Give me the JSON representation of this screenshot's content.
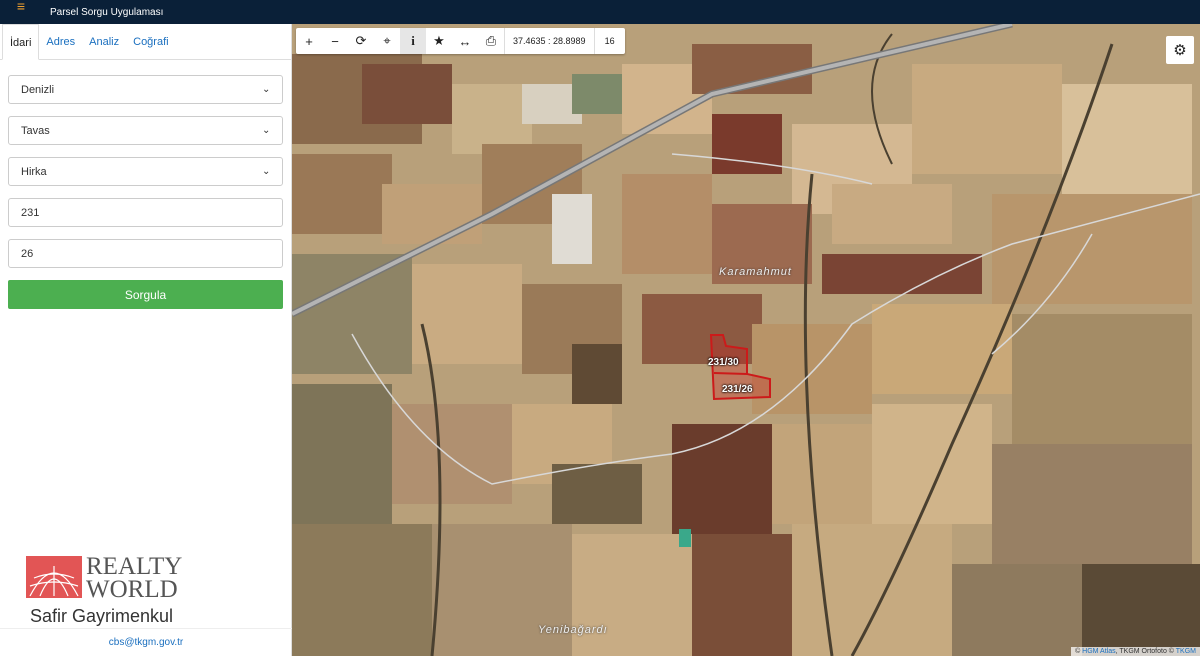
{
  "app": {
    "title": "Parsel Sorgu Uygulaması",
    "menu_icon": "hamburger-icon"
  },
  "tabs": [
    {
      "label": "İdari",
      "active": true
    },
    {
      "label": "Adres",
      "active": false
    },
    {
      "label": "Analiz",
      "active": false
    },
    {
      "label": "Coğrafi",
      "active": false
    }
  ],
  "form": {
    "province": "Denizli",
    "district": "Tavas",
    "neighborhood": "Hirka",
    "block": "231",
    "parcel": "26",
    "query_label": "Sorgula"
  },
  "logo": {
    "line1": "REALTY",
    "line2": "WORLD",
    "subtitle": "Safir Gayrimenkul"
  },
  "footer": {
    "email": "cbs@tkgm.gov.tr"
  },
  "map": {
    "coords": "37.4635 : 28.8989",
    "zoom": "16",
    "places": [
      "Karamahmut",
      "Yenibağardı"
    ],
    "parcels": [
      "231/30",
      "231/26"
    ],
    "attribution_prefix": "© ",
    "attribution_link1": "HGM Atlas",
    "attribution_mid": ", TKGM Ortofoto © ",
    "attribution_link2": "TKGM",
    "parcel_color": "#cc1a1a",
    "accent_color": "#4caf50"
  }
}
